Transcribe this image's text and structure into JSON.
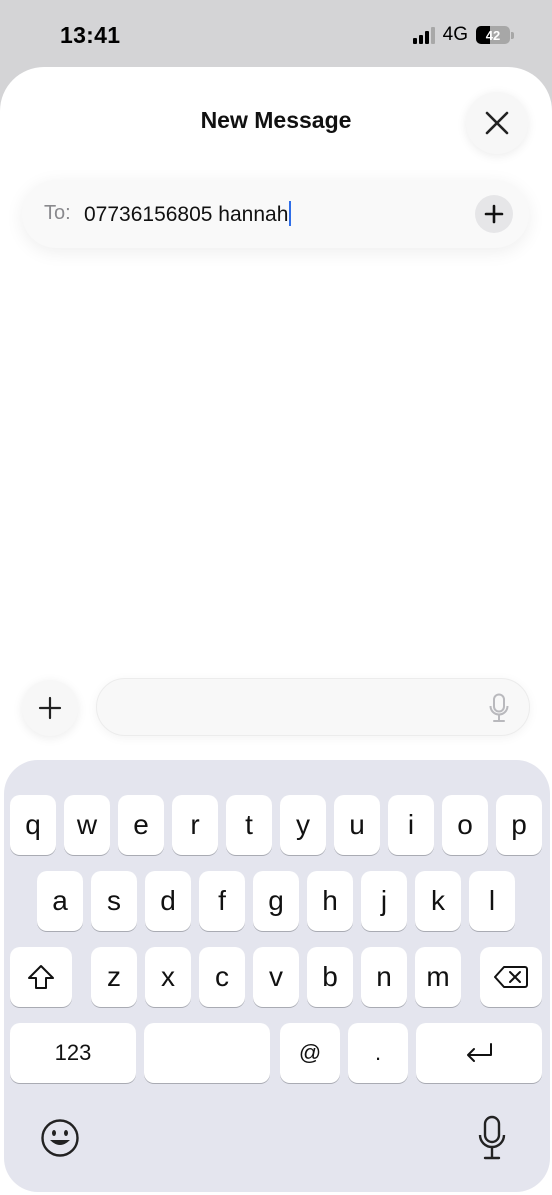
{
  "status_bar": {
    "time": "13:41",
    "network": "4G",
    "battery": "42"
  },
  "sheet": {
    "title": "New Message",
    "close_icon": "close-icon"
  },
  "recipient": {
    "label": "To:",
    "value": "07736156805 hannah",
    "add_icon": "plus-icon"
  },
  "compose": {
    "add_icon": "plus-icon",
    "input_value": "",
    "mic_icon": "microphone-icon"
  },
  "keyboard": {
    "row1": [
      "q",
      "w",
      "e",
      "r",
      "t",
      "y",
      "u",
      "i",
      "o",
      "p"
    ],
    "row2": [
      "a",
      "s",
      "d",
      "f",
      "g",
      "h",
      "j",
      "k",
      "l"
    ],
    "row3": [
      "z",
      "x",
      "c",
      "v",
      "b",
      "n",
      "m"
    ],
    "shift_icon": "shift-icon",
    "delete_icon": "delete-icon",
    "numbers_label": "123",
    "space_label": "",
    "at_label": "@",
    "period_label": ".",
    "return_icon": "return-icon",
    "emoji_icon": "emoji-icon",
    "dictation_icon": "microphone-icon"
  }
}
